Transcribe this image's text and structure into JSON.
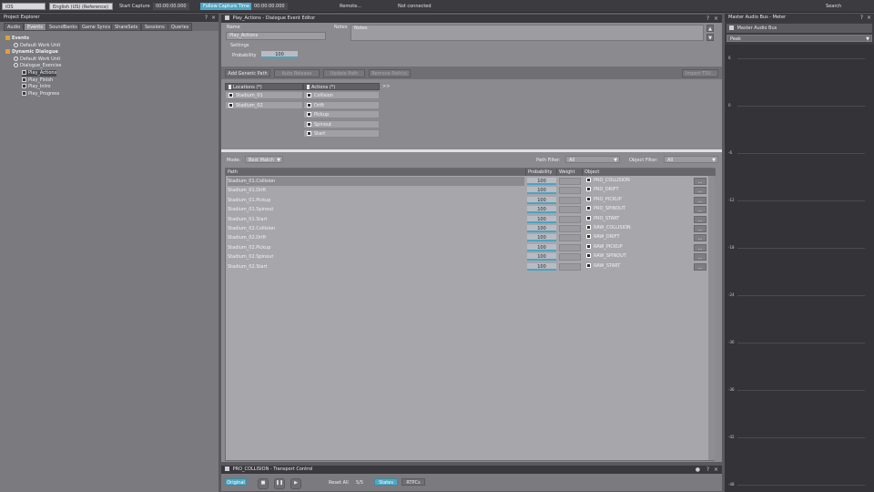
{
  "topbar": {
    "platform": "iOS",
    "language": "English (US) (Reference)",
    "start_capture": "Start Capture",
    "time1": "00:00:00.000",
    "follow_capture": "Follow Capture Time",
    "time2": "00:00:00.000",
    "remote": "Remote...",
    "connection": "Not connected",
    "search": "Search"
  },
  "project_explorer": {
    "title": "Project Explorer",
    "tabs": [
      "Audio",
      "Events",
      "SoundBanks",
      "Game Syncs",
      "ShareSets",
      "Sessions",
      "Queries"
    ],
    "tree": [
      {
        "label": "Events",
        "kind": "folder",
        "depth": 0,
        "bold": true
      },
      {
        "label": "Default Work Unit",
        "kind": "wu",
        "depth": 1
      },
      {
        "label": "Dynamic Dialogue",
        "kind": "folder",
        "depth": 0,
        "bold": true
      },
      {
        "label": "Default Work Unit",
        "kind": "wu",
        "depth": 1
      },
      {
        "label": "Dialogue_Exercise",
        "kind": "wu",
        "depth": 1
      },
      {
        "label": "Play_Actions",
        "kind": "ev",
        "depth": 2,
        "selected": true
      },
      {
        "label": "Play_Finish",
        "kind": "ev",
        "depth": 2
      },
      {
        "label": "Play_Intro",
        "kind": "ev",
        "depth": 2
      },
      {
        "label": "Play_Progress",
        "kind": "ev",
        "depth": 2
      }
    ]
  },
  "editor": {
    "title": "Play_Actions - Dialogue Event Editor",
    "name_label": "Name",
    "name_value": "Play_Actions",
    "notes_label": "Notes",
    "notes_value": "Notes",
    "settings_label": "Settings",
    "probability_label": "Probability",
    "probability_value": "100",
    "buttons": {
      "add_generic": "Add Generic Path",
      "auto_release": "Auto Release",
      "update_path": "Update Path",
      "remove_path": "Remove Path(s)",
      "import": "Import TSV..."
    },
    "arg_columns": [
      {
        "header": "Locations (*)",
        "values": [
          "Stadium_01",
          "Stadium_02"
        ]
      },
      {
        "header": "Actions (*)",
        "values": [
          "Collision",
          "Drift",
          "Pickup",
          "Spinout",
          "Start"
        ]
      }
    ],
    "expand": ">>",
    "mode_label": "Mode:",
    "mode_value": "Best Match",
    "path_filter_label": "Path Filter:",
    "path_filter_value": "All",
    "object_filter_label": "Object Filter:",
    "object_filter_value": "All",
    "grid_headers": {
      "path": "Path",
      "probability": "Probability",
      "weight": "Weight",
      "object": "Object"
    },
    "rows": [
      {
        "path": "Stadium_01.Collision",
        "probability": "100",
        "object": "PRO_COLLISION"
      },
      {
        "path": "Stadium_01.Drift",
        "probability": "100",
        "object": "PRO_DRIFT"
      },
      {
        "path": "Stadium_01.Pickup",
        "probability": "100",
        "object": "PRO_PICKUP"
      },
      {
        "path": "Stadium_01.Spinout",
        "probability": "100",
        "object": "PRO_SPINOUT"
      },
      {
        "path": "Stadium_01.Start",
        "probability": "100",
        "object": "PRO_START"
      },
      {
        "path": "Stadium_02.Collision",
        "probability": "100",
        "object": "RAW_COLLISION"
      },
      {
        "path": "Stadium_02.Drift",
        "probability": "100",
        "object": "RAW_DRIFT"
      },
      {
        "path": "Stadium_02.Pickup",
        "probability": "100",
        "object": "RAW_PICKUP"
      },
      {
        "path": "Stadium_02.Spinout",
        "probability": "100",
        "object": "RAW_SPINOUT"
      },
      {
        "path": "Stadium_02.Start",
        "probability": "100",
        "object": "RAW_START"
      }
    ],
    "row_button": "..."
  },
  "transport": {
    "title": "PRO_COLLISION - Transport Control",
    "original": "Original",
    "reset_all": "Reset All",
    "counter": "5/5",
    "states": "States",
    "rtpcs": "RTPCs"
  },
  "meter": {
    "title": "Master Audio Bus - Meter",
    "bus": "Master Audio Bus",
    "mode": "Peak",
    "ticks": [
      "6",
      "0",
      "-6",
      "-12",
      "-18",
      "-24",
      "-30",
      "-36",
      "-42",
      "-48"
    ]
  },
  "colors": {
    "accent": "#4fa7c4",
    "panel": "#7a7a7f",
    "editor": "#8a8a8f",
    "dark": "#3a3a3e"
  }
}
